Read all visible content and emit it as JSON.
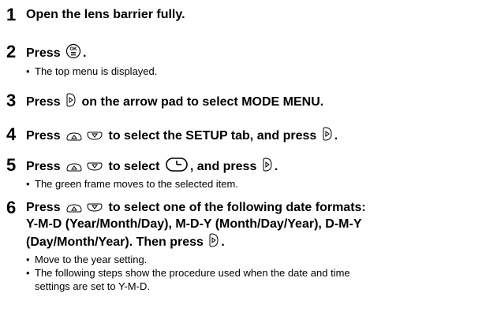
{
  "steps": [
    {
      "num": "1",
      "text": "Open the lens barrier fully."
    },
    {
      "num": "2",
      "pre": "Press",
      "post": ".",
      "note": "The top menu is displayed.",
      "icon": "ok-menu-button-icon"
    },
    {
      "num": "3",
      "pre": "Press",
      "post": "on the arrow pad to select MODE MENU.",
      "icon": "arrow-right-icon"
    },
    {
      "num": "4",
      "pre": "Press",
      "mid": "to select the SETUP tab, and press",
      "post": ".",
      "icons": [
        "arrow-up-icon",
        "arrow-down-icon",
        "arrow-right-icon"
      ]
    },
    {
      "num": "5",
      "pre": "Press",
      "mid": "to select",
      "mid2": ", and press",
      "post": ".",
      "note": "The green frame moves to the selected item.",
      "icons": [
        "arrow-up-icon",
        "arrow-down-icon",
        "clock-icon",
        "arrow-right-icon"
      ]
    },
    {
      "num": "6",
      "pre": "Press",
      "line1": "to select one of the following date formats:",
      "line2": "Y-M-D (Year/Month/Day), M-D-Y (Month/Day/Year), D-M-Y",
      "line3": "(Day/Month/Year). Then press",
      "post": ".",
      "notes": [
        "Move to the year setting.",
        "The following steps show the procedure used when the date and time",
        "settings are set to Y-M-D."
      ],
      "icons": [
        "arrow-up-icon",
        "arrow-down-icon",
        "arrow-right-icon"
      ]
    }
  ],
  "bullet": "•",
  "ok_label": "OK"
}
